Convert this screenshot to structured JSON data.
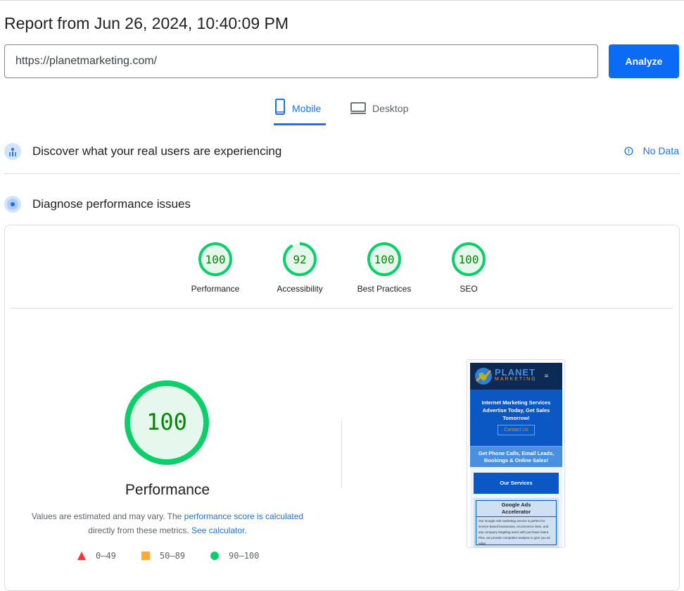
{
  "report": {
    "title": "Report from Jun 26, 2024, 10:40:09 PM"
  },
  "search": {
    "url": "https://planetmarketing.com/",
    "analyze_label": "Analyze"
  },
  "tabs": [
    {
      "label": "Mobile",
      "active": true
    },
    {
      "label": "Desktop",
      "active": false
    }
  ],
  "sections": {
    "discover": {
      "label": "Discover what your real users are experiencing",
      "status": "No Data"
    },
    "diagnose": {
      "label": "Diagnose performance issues"
    }
  },
  "scores": [
    {
      "label": "Performance",
      "value": 100
    },
    {
      "label": "Accessibility",
      "value": 92
    },
    {
      "label": "Best Practices",
      "value": 100
    },
    {
      "label": "SEO",
      "value": 100
    }
  ],
  "performance": {
    "score": 100,
    "title": "Performance",
    "desc_prefix": "Values are estimated and may vary. The ",
    "desc_link1": "performance score is calculated",
    "desc_mid": " directly from these metrics. ",
    "desc_link2": "See calculator."
  },
  "legend": [
    {
      "icon": "red-triangle",
      "range": "0–49",
      "color": "#ff3333"
    },
    {
      "icon": "orange-square",
      "range": "50–89",
      "color": "#ffaa33"
    },
    {
      "icon": "green-circle",
      "range": "90–100",
      "color": "#0cce6b"
    }
  ],
  "screenshot": {
    "brand_top": "PLANET",
    "brand_bottom": "MARKETING",
    "hero_lines": [
      "Internet Marketing Services",
      "Advertise Today, Get Sales",
      "Tomorrow!"
    ],
    "cta": "Contact Us",
    "band_lines": [
      "Get Phone Calls, Email Leads,",
      "Bookings & Online Sales!"
    ],
    "services": "Our Services",
    "card_title_lines": [
      "Google Ads",
      "Accelerator"
    ],
    "card_text": "Our Google Ads marketing service is perfect for service-based businesses, eCommerce sites, and any company targeting users with purchase intent. Plus, we provide competitor analysis to give you an edge."
  },
  "colors": {
    "accent": "#1a73e8",
    "pass": "#0cce6b",
    "pass_text": "#008800",
    "pass_fill": "#e6f8ee"
  }
}
